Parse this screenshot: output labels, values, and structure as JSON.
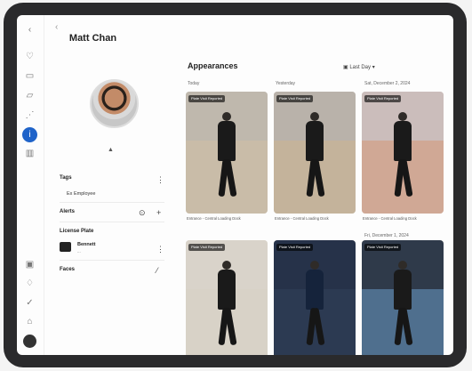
{
  "profile": {
    "name": "Matt Chan",
    "tags_label": "Tags",
    "tag": "Ex Employee",
    "alerts_label": "Alerts",
    "license_label": "License Plate",
    "license_name": "Bennett",
    "license_sub": "...",
    "faces_label": "Faces"
  },
  "appearances": {
    "title": "Appearances",
    "filter": "Last Day",
    "dates": [
      "Today",
      "Yesterday",
      "Sat, December 2, 2024",
      "Fri, December 1, 2024"
    ],
    "badges": [
      "Plate Visit Reported",
      "Plate Visit Reported",
      "Plate Visit Reported",
      "Plate Visit Reported",
      "Plate Visit Reported",
      "Plate Visit Reported"
    ],
    "captions": [
      "Entrance - Central Loading Dock",
      "Entrance - Central Loading Dock",
      "Entrance - Central Loading Dock",
      "",
      "",
      ""
    ]
  },
  "colors": {
    "accent": "#1f63c9",
    "frame": "#2a2a2c"
  },
  "icons": [
    "chevron-left-icon",
    "heart-icon",
    "document-icon",
    "folder-icon",
    "hierarchy-icon",
    "person-icon",
    "layers-icon",
    "camera-icon",
    "bell-icon",
    "check-icon",
    "home-icon",
    "more-icon",
    "add-icon"
  ]
}
